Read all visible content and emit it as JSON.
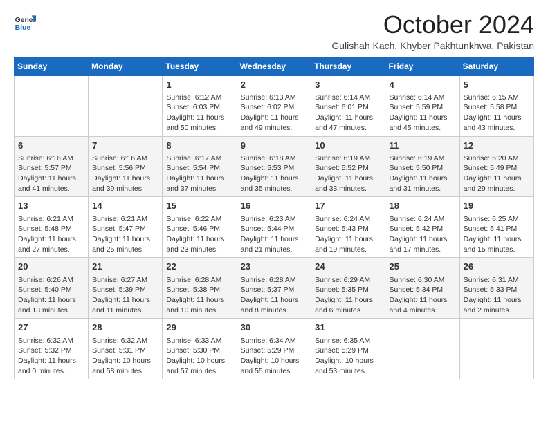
{
  "header": {
    "logo_general": "General",
    "logo_blue": "Blue",
    "month_title": "October 2024",
    "subtitle": "Gulishah Kach, Khyber Pakhtunkhwa, Pakistan"
  },
  "days_of_week": [
    "Sunday",
    "Monday",
    "Tuesday",
    "Wednesday",
    "Thursday",
    "Friday",
    "Saturday"
  ],
  "weeks": [
    [
      {
        "day": "",
        "sunrise": "",
        "sunset": "",
        "daylight": ""
      },
      {
        "day": "",
        "sunrise": "",
        "sunset": "",
        "daylight": ""
      },
      {
        "day": "1",
        "sunrise": "Sunrise: 6:12 AM",
        "sunset": "Sunset: 6:03 PM",
        "daylight": "Daylight: 11 hours and 50 minutes."
      },
      {
        "day": "2",
        "sunrise": "Sunrise: 6:13 AM",
        "sunset": "Sunset: 6:02 PM",
        "daylight": "Daylight: 11 hours and 49 minutes."
      },
      {
        "day": "3",
        "sunrise": "Sunrise: 6:14 AM",
        "sunset": "Sunset: 6:01 PM",
        "daylight": "Daylight: 11 hours and 47 minutes."
      },
      {
        "day": "4",
        "sunrise": "Sunrise: 6:14 AM",
        "sunset": "Sunset: 5:59 PM",
        "daylight": "Daylight: 11 hours and 45 minutes."
      },
      {
        "day": "5",
        "sunrise": "Sunrise: 6:15 AM",
        "sunset": "Sunset: 5:58 PM",
        "daylight": "Daylight: 11 hours and 43 minutes."
      }
    ],
    [
      {
        "day": "6",
        "sunrise": "Sunrise: 6:16 AM",
        "sunset": "Sunset: 5:57 PM",
        "daylight": "Daylight: 11 hours and 41 minutes."
      },
      {
        "day": "7",
        "sunrise": "Sunrise: 6:16 AM",
        "sunset": "Sunset: 5:56 PM",
        "daylight": "Daylight: 11 hours and 39 minutes."
      },
      {
        "day": "8",
        "sunrise": "Sunrise: 6:17 AM",
        "sunset": "Sunset: 5:54 PM",
        "daylight": "Daylight: 11 hours and 37 minutes."
      },
      {
        "day": "9",
        "sunrise": "Sunrise: 6:18 AM",
        "sunset": "Sunset: 5:53 PM",
        "daylight": "Daylight: 11 hours and 35 minutes."
      },
      {
        "day": "10",
        "sunrise": "Sunrise: 6:19 AM",
        "sunset": "Sunset: 5:52 PM",
        "daylight": "Daylight: 11 hours and 33 minutes."
      },
      {
        "day": "11",
        "sunrise": "Sunrise: 6:19 AM",
        "sunset": "Sunset: 5:50 PM",
        "daylight": "Daylight: 11 hours and 31 minutes."
      },
      {
        "day": "12",
        "sunrise": "Sunrise: 6:20 AM",
        "sunset": "Sunset: 5:49 PM",
        "daylight": "Daylight: 11 hours and 29 minutes."
      }
    ],
    [
      {
        "day": "13",
        "sunrise": "Sunrise: 6:21 AM",
        "sunset": "Sunset: 5:48 PM",
        "daylight": "Daylight: 11 hours and 27 minutes."
      },
      {
        "day": "14",
        "sunrise": "Sunrise: 6:21 AM",
        "sunset": "Sunset: 5:47 PM",
        "daylight": "Daylight: 11 hours and 25 minutes."
      },
      {
        "day": "15",
        "sunrise": "Sunrise: 6:22 AM",
        "sunset": "Sunset: 5:46 PM",
        "daylight": "Daylight: 11 hours and 23 minutes."
      },
      {
        "day": "16",
        "sunrise": "Sunrise: 6:23 AM",
        "sunset": "Sunset: 5:44 PM",
        "daylight": "Daylight: 11 hours and 21 minutes."
      },
      {
        "day": "17",
        "sunrise": "Sunrise: 6:24 AM",
        "sunset": "Sunset: 5:43 PM",
        "daylight": "Daylight: 11 hours and 19 minutes."
      },
      {
        "day": "18",
        "sunrise": "Sunrise: 6:24 AM",
        "sunset": "Sunset: 5:42 PM",
        "daylight": "Daylight: 11 hours and 17 minutes."
      },
      {
        "day": "19",
        "sunrise": "Sunrise: 6:25 AM",
        "sunset": "Sunset: 5:41 PM",
        "daylight": "Daylight: 11 hours and 15 minutes."
      }
    ],
    [
      {
        "day": "20",
        "sunrise": "Sunrise: 6:26 AM",
        "sunset": "Sunset: 5:40 PM",
        "daylight": "Daylight: 11 hours and 13 minutes."
      },
      {
        "day": "21",
        "sunrise": "Sunrise: 6:27 AM",
        "sunset": "Sunset: 5:39 PM",
        "daylight": "Daylight: 11 hours and 11 minutes."
      },
      {
        "day": "22",
        "sunrise": "Sunrise: 6:28 AM",
        "sunset": "Sunset: 5:38 PM",
        "daylight": "Daylight: 11 hours and 10 minutes."
      },
      {
        "day": "23",
        "sunrise": "Sunrise: 6:28 AM",
        "sunset": "Sunset: 5:37 PM",
        "daylight": "Daylight: 11 hours and 8 minutes."
      },
      {
        "day": "24",
        "sunrise": "Sunrise: 6:29 AM",
        "sunset": "Sunset: 5:35 PM",
        "daylight": "Daylight: 11 hours and 6 minutes."
      },
      {
        "day": "25",
        "sunrise": "Sunrise: 6:30 AM",
        "sunset": "Sunset: 5:34 PM",
        "daylight": "Daylight: 11 hours and 4 minutes."
      },
      {
        "day": "26",
        "sunrise": "Sunrise: 6:31 AM",
        "sunset": "Sunset: 5:33 PM",
        "daylight": "Daylight: 11 hours and 2 minutes."
      }
    ],
    [
      {
        "day": "27",
        "sunrise": "Sunrise: 6:32 AM",
        "sunset": "Sunset: 5:32 PM",
        "daylight": "Daylight: 11 hours and 0 minutes."
      },
      {
        "day": "28",
        "sunrise": "Sunrise: 6:32 AM",
        "sunset": "Sunset: 5:31 PM",
        "daylight": "Daylight: 10 hours and 58 minutes."
      },
      {
        "day": "29",
        "sunrise": "Sunrise: 6:33 AM",
        "sunset": "Sunset: 5:30 PM",
        "daylight": "Daylight: 10 hours and 57 minutes."
      },
      {
        "day": "30",
        "sunrise": "Sunrise: 6:34 AM",
        "sunset": "Sunset: 5:29 PM",
        "daylight": "Daylight: 10 hours and 55 minutes."
      },
      {
        "day": "31",
        "sunrise": "Sunrise: 6:35 AM",
        "sunset": "Sunset: 5:29 PM",
        "daylight": "Daylight: 10 hours and 53 minutes."
      },
      {
        "day": "",
        "sunrise": "",
        "sunset": "",
        "daylight": ""
      },
      {
        "day": "",
        "sunrise": "",
        "sunset": "",
        "daylight": ""
      }
    ]
  ]
}
